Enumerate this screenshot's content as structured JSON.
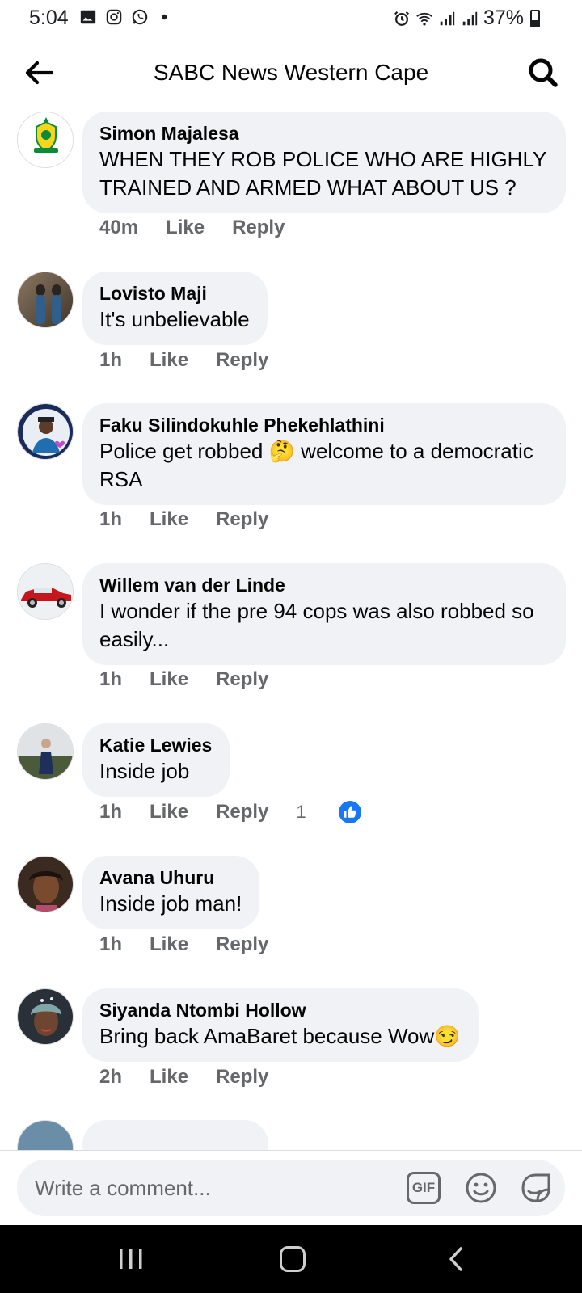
{
  "status_bar": {
    "time": "5:04",
    "battery": "37%",
    "left_icons": [
      "gallery-icon",
      "instagram-icon",
      "whatsapp-icon",
      "dot-icon"
    ],
    "right_icons": [
      "alarm-icon",
      "wifi-icon",
      "signal-icon",
      "signal-icon",
      "battery-icon"
    ]
  },
  "header": {
    "title": "SABC News Western Cape"
  },
  "comments": [
    {
      "author": "Simon Majalesa",
      "text": "WHEN THEY ROB POLICE WHO ARE HIGHLY TRAINED AND ARMED WHAT ABOUT US ?",
      "time": "40m",
      "like": "Like",
      "reply": "Reply"
    },
    {
      "author": "Lovisto Maji",
      "text": "It's unbelievable",
      "time": "1h",
      "like": "Like",
      "reply": "Reply"
    },
    {
      "author": "Faku Silindokuhle Phekehlathini",
      "text": "Police  get robbed  🤔 welcome to a democratic RSA",
      "time": "1h",
      "like": "Like",
      "reply": "Reply"
    },
    {
      "author": "Willem van der Linde",
      "text": "I wonder if the pre 94 cops was also robbed so easily...",
      "time": "1h",
      "like": "Like",
      "reply": "Reply"
    },
    {
      "author": "Katie Lewies",
      "text": "Inside job",
      "time": "1h",
      "like": "Like",
      "reply": "Reply",
      "reactions": "1"
    },
    {
      "author": "Avana Uhuru",
      "text": "Inside job man!",
      "time": "1h",
      "like": "Like",
      "reply": "Reply"
    },
    {
      "author": "Siyanda Ntombi Hollow",
      "text": "Bring back AmaBaret because Wow😏",
      "time": "2h",
      "like": "Like",
      "reply": "Reply"
    }
  ],
  "composer": {
    "placeholder": "Write a comment...",
    "gif_label": "GIF"
  },
  "colors": {
    "bubble": "#f0f2f5",
    "secondary_text": "#65676b",
    "like_blue": "#1877f2"
  }
}
